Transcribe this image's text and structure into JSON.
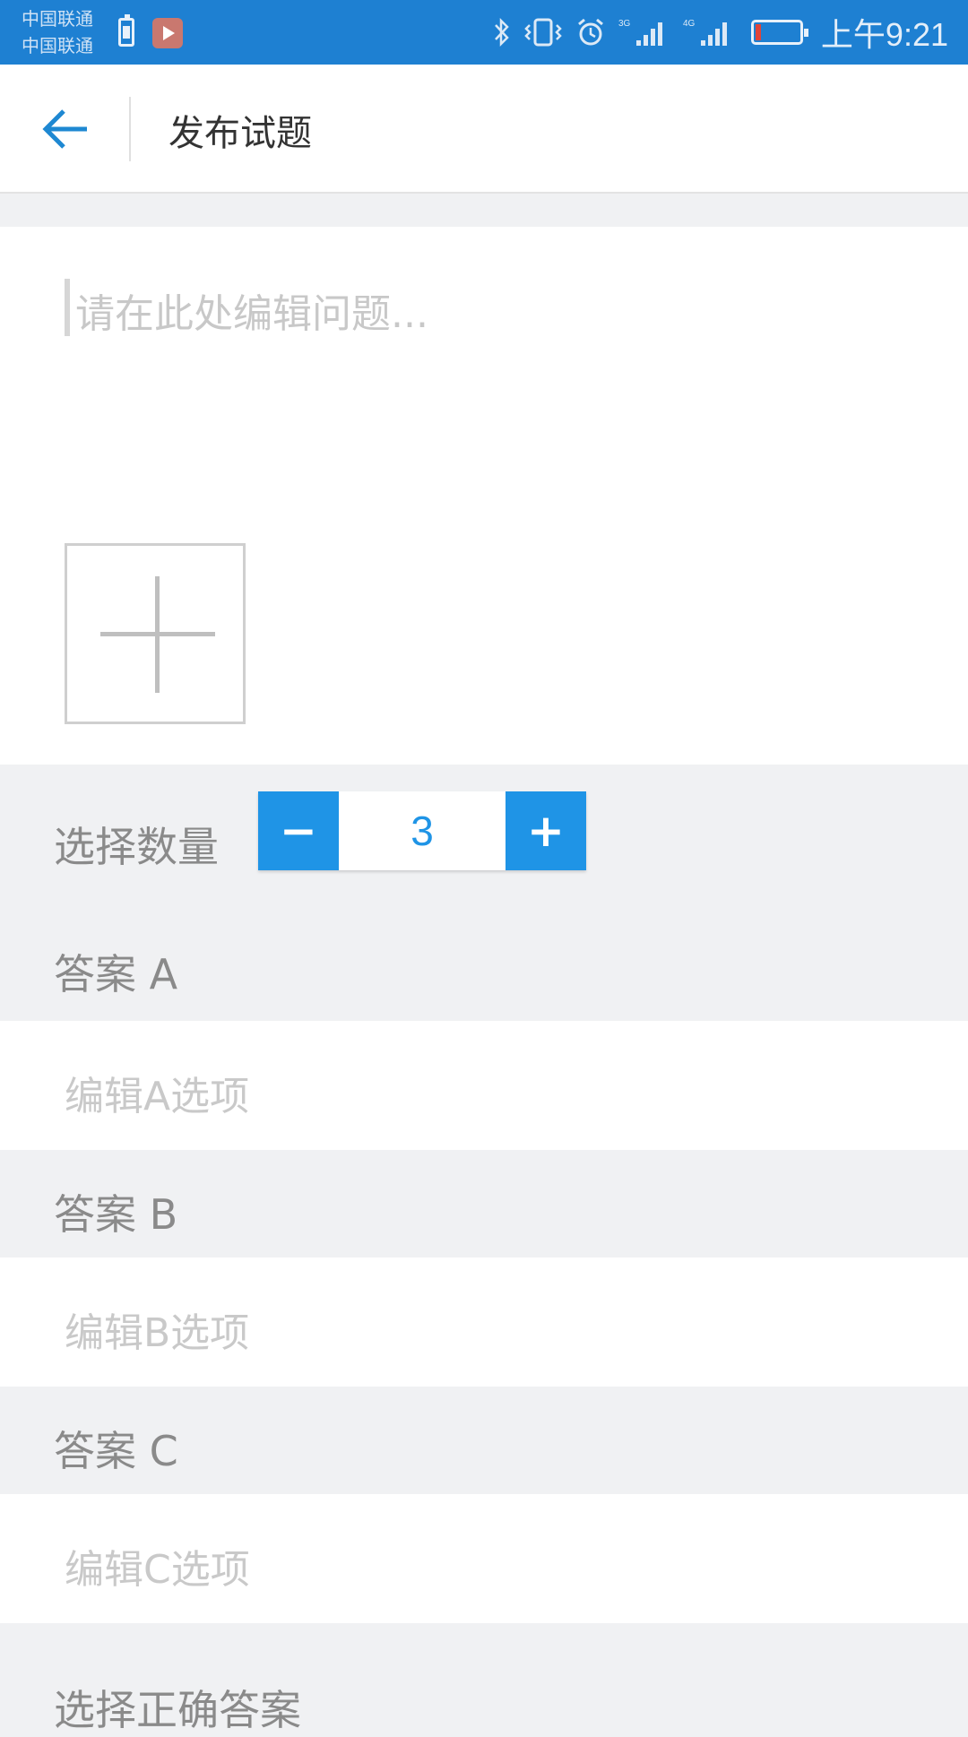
{
  "status_bar": {
    "carrier_1": "中国联通",
    "carrier_2": "中国联通",
    "network_1": "3G",
    "network_2": "4G",
    "time": "上午9:21",
    "icons": [
      "battery-icon",
      "app-icon",
      "bluetooth-icon",
      "vibrate-icon",
      "alarm-icon",
      "signal-icon",
      "signal-icon",
      "battery-icon"
    ],
    "color": "#1e80d2"
  },
  "app_bar": {
    "title": "发布试题",
    "back_icon": "arrow-left-icon",
    "accent": "#1e88d2"
  },
  "question": {
    "placeholder": "请在此处编辑问题...",
    "add_image_icon": "plus-icon"
  },
  "quantity": {
    "label": "选择数量",
    "minus_label": "−",
    "plus_label": "+",
    "value": "3",
    "accent": "#1f94e6"
  },
  "answers": [
    {
      "header": "答案 A",
      "placeholder": "编辑A选项"
    },
    {
      "header": "答案 B",
      "placeholder": "编辑B选项"
    },
    {
      "header": "答案 C",
      "placeholder": "编辑C选项"
    }
  ],
  "correct_answer": {
    "label": "选择正确答案"
  }
}
